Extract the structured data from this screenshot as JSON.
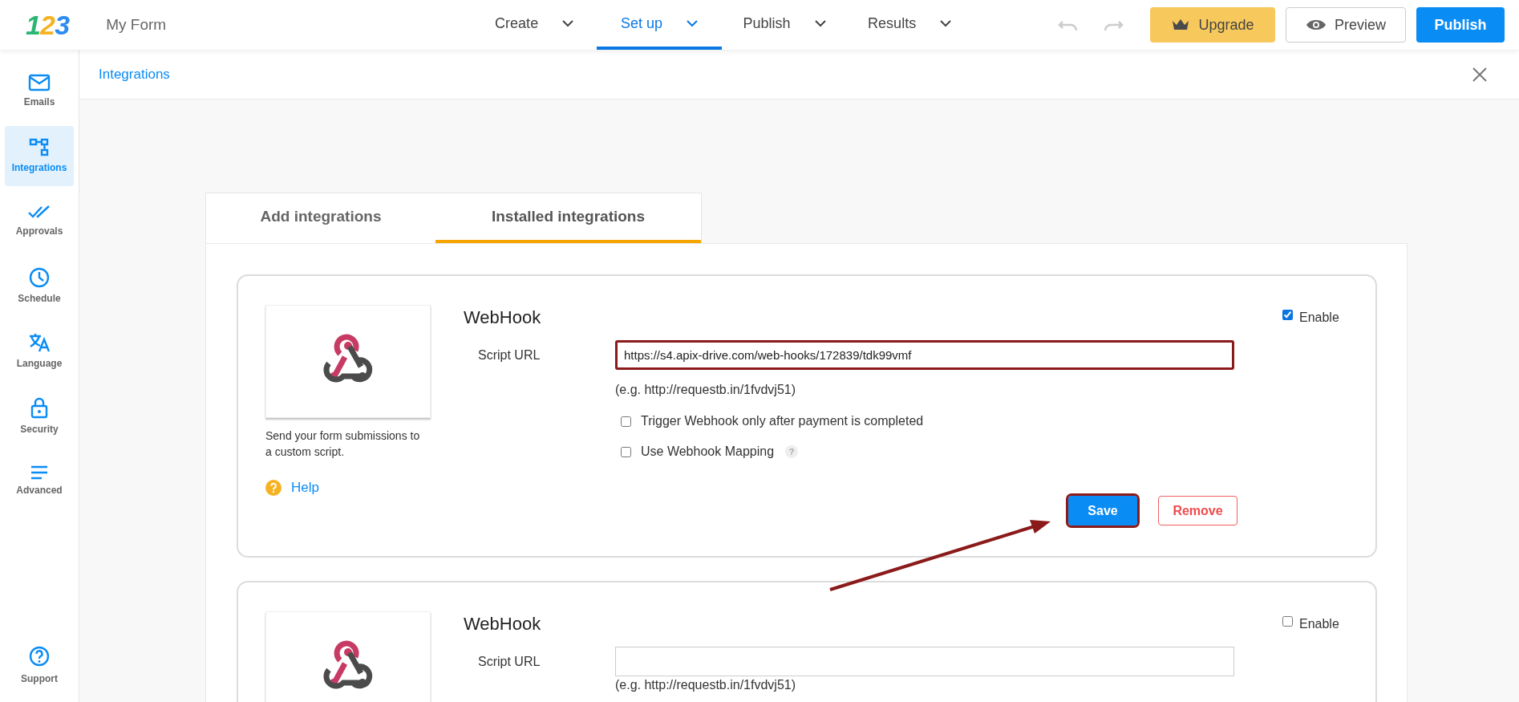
{
  "app": {
    "logo": "123",
    "form_name": "My Form"
  },
  "nav": [
    {
      "label": "Create",
      "selected": false
    },
    {
      "label": "Set up",
      "selected": true
    },
    {
      "label": "Publish",
      "selected": false
    },
    {
      "label": "Results",
      "selected": false
    }
  ],
  "toolbar": {
    "buttons": [
      {
        "kind": "upgrade",
        "label": "Upgrade"
      },
      {
        "kind": "preview",
        "label": "Preview"
      },
      {
        "kind": "publish",
        "label": "Publish"
      }
    ]
  },
  "sidebar": {
    "items": [
      {
        "label": "Emails",
        "selected": false
      },
      {
        "label": "Integrations",
        "selected": true
      },
      {
        "label": "Approvals",
        "selected": false
      },
      {
        "label": "Schedule",
        "selected": false
      },
      {
        "label": "Language",
        "selected": false
      },
      {
        "label": "Security",
        "selected": false
      },
      {
        "label": "Advanced",
        "selected": false
      }
    ],
    "footer": {
      "label": "Support"
    }
  },
  "header": {
    "title": "Integrations"
  },
  "tabs": [
    {
      "label": "Add integrations",
      "selected": false
    },
    {
      "label": "Installed integrations",
      "selected": true
    }
  ],
  "integrations": [
    {
      "title": "WebHook",
      "description": "Send your form submissions to a custom script.",
      "help": "Help",
      "enable_label": "Enable",
      "enabled": true,
      "url_label": "Script URL",
      "url": "https://s4.apix-drive.com/web-hooks/172839/tdk99vmf",
      "url_highlighted": true,
      "example": "(e.g. http://requestb.in/1fvdvj51)",
      "options": [
        {
          "label": "Trigger Webhook only after payment is completed",
          "checked": false
        },
        {
          "label": "Use Webhook Mapping",
          "checked": false,
          "hint": "?"
        }
      ],
      "buttons": [
        {
          "kind": "save",
          "label": "Save",
          "highlighted": true
        },
        {
          "kind": "remove",
          "label": "Remove",
          "highlighted": false
        }
      ]
    },
    {
      "title": "WebHook",
      "enable_label": "Enable",
      "enabled": false,
      "url_label": "Script URL",
      "url_highlighted": false,
      "example": "(e.g. http://requestb.in/1fvdvj51)"
    }
  ],
  "annotation": {
    "arrow": true
  }
}
